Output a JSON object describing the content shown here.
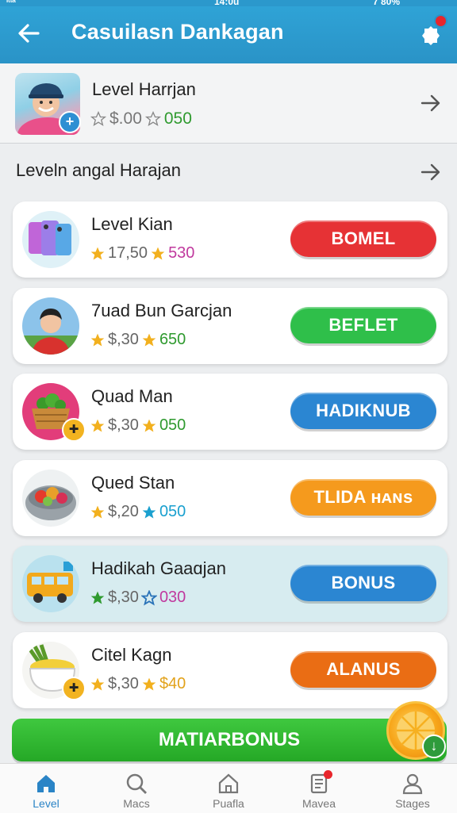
{
  "status": {
    "left": "ᴵᵗᵗᵃ",
    "center": "14:0u",
    "right": "7 80%"
  },
  "header": {
    "title": "Casuilasn Dankagan",
    "back_icon": "back-arrow-icon",
    "settings_icon": "gear-icon"
  },
  "profile": {
    "name": "Level Harrjan",
    "stat1": "$.00",
    "stat2": "050"
  },
  "section": {
    "title": "Leveln angal Harajan"
  },
  "cards": [
    {
      "name": "Level Kian",
      "stat1": "17,50",
      "stat2": "530",
      "button": "BOMEL",
      "button_color": "#e63235",
      "stat2_color": "#c0399e"
    },
    {
      "name": "7uad Bun Garcjan",
      "stat1": "$,30",
      "stat2": "650",
      "button": "BEFLET",
      "button_color": "#2fbf4a",
      "stat2_color": "#2f9a2f"
    },
    {
      "name": "Quad Man",
      "stat1": "$,30",
      "stat2": "050",
      "button": "HADIKNUB",
      "button_color": "#2b86d2",
      "stat2_color": "#2f9a2f"
    },
    {
      "name": "Qued Stan",
      "stat1": "$,20",
      "stat2": "050",
      "button": "TLIDA ʜᴀɴs",
      "button_color": "#f59a1d",
      "stat2_color": "#1aa0cf"
    },
    {
      "name": "Hadikah Gaaɑjan",
      "stat1": "$,30",
      "stat2": "030",
      "button": "BONUS",
      "button_color": "#2b86d2",
      "stat2_color": "#c0399e"
    },
    {
      "name": "Citel Kagn",
      "stat1": "$,30",
      "stat2": "$40",
      "button": "ALANUS",
      "button_color": "#ea6d14",
      "stat2_color": "#e2a21b"
    }
  ],
  "main_button": "MATIARBONUS",
  "nav": [
    {
      "label": "Level",
      "icon": "home-icon",
      "active": true
    },
    {
      "label": "Macs",
      "icon": "search-icon",
      "active": false
    },
    {
      "label": "Puafla",
      "icon": "house-outline-icon",
      "active": false
    },
    {
      "label": "Mavea",
      "icon": "document-icon",
      "active": false
    },
    {
      "label": "Stages",
      "icon": "user-icon",
      "active": false
    }
  ],
  "colors": {
    "header": "#2a93c7",
    "accent": "#2a84c6",
    "green": "#25a826"
  }
}
